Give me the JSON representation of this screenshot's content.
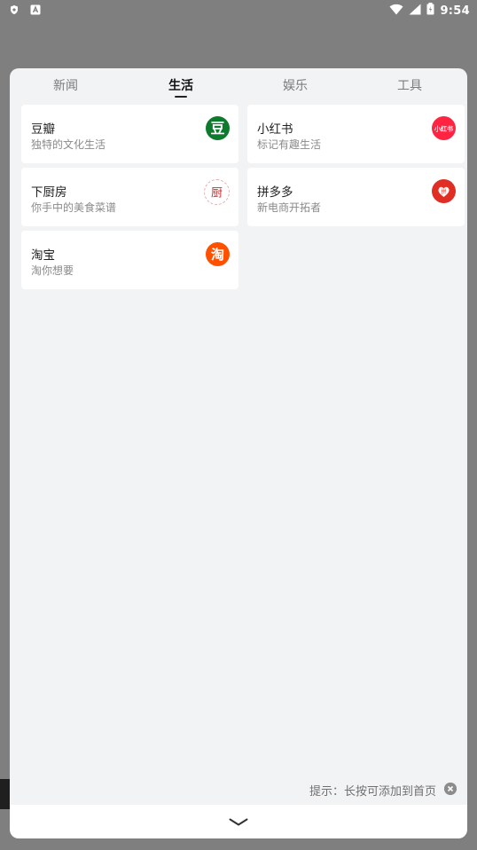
{
  "status_bar": {
    "time": "9:54"
  },
  "tabs": [
    {
      "label": "新闻",
      "active": false
    },
    {
      "label": "生活",
      "active": true
    },
    {
      "label": "娱乐",
      "active": false
    },
    {
      "label": "工具",
      "active": false
    }
  ],
  "apps": [
    {
      "name": "豆瓣",
      "desc": "独特的文化生活",
      "logo_text": "豆",
      "logo_color": "#0e7a2e",
      "logo_text_color": "#ffffff"
    },
    {
      "name": "小红书",
      "desc": "标记有趣生活",
      "logo_text": "小红书",
      "logo_color": "#ff2442",
      "logo_text_color": "#ffffff"
    },
    {
      "name": "下厨房",
      "desc": "你手中的美食菜谱",
      "logo_text": "厨",
      "logo_color": "#ffffff",
      "logo_text_color": "#d12b2b"
    },
    {
      "name": "拼多多",
      "desc": "新电商开拓者",
      "logo_text": "拼",
      "logo_color": "#e02e24",
      "logo_text_color": "#ffffff"
    },
    {
      "name": "淘宝",
      "desc": "淘你想要",
      "logo_text": "淘",
      "logo_color": "#ff5000",
      "logo_text_color": "#ffffff"
    }
  ],
  "hint": {
    "text": "提示：长按可添加到首页"
  },
  "icons": {
    "collapse": "chevron-down-icon",
    "close": "close-icon"
  }
}
